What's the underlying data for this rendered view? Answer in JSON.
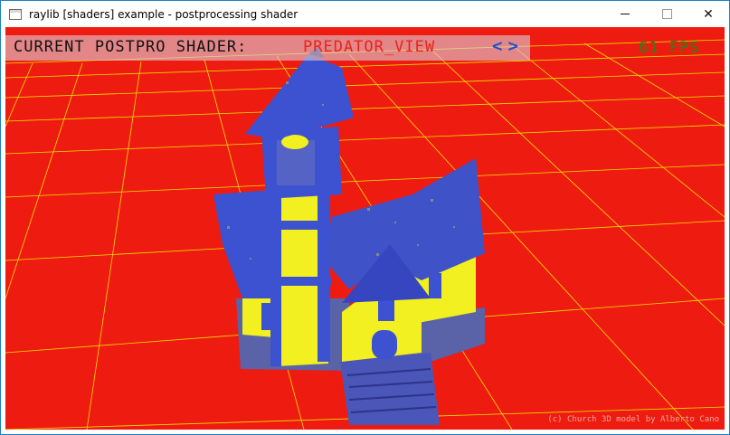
{
  "window": {
    "title": "raylib [shaders] example - postprocessing shader",
    "minimize_glyph": "",
    "maximize_glyph": "☐",
    "close_glyph": "✕"
  },
  "hud": {
    "label": "CURRENT POSTPRO SHADER:",
    "shader_name": "PREDATOR_VIEW",
    "prev_glyph": "<",
    "next_glyph": ">",
    "fps": "61 FPS",
    "credit": "(c) Church 3D model by Alberto Cano"
  },
  "colors": {
    "background": "#ee1c10",
    "grid": "#f0e000",
    "model_blue": "#3d52d0",
    "model_yellow": "#f2f020",
    "fps": "#1a8a1a",
    "shader_name": "#e8241a",
    "arrows": "#1e4fd6"
  },
  "icons": {
    "app": "window-app-icon",
    "minimize": "minimize-icon",
    "maximize": "maximize-icon",
    "close": "close-icon",
    "prev": "chevron-left-icon",
    "next": "chevron-right-icon"
  }
}
